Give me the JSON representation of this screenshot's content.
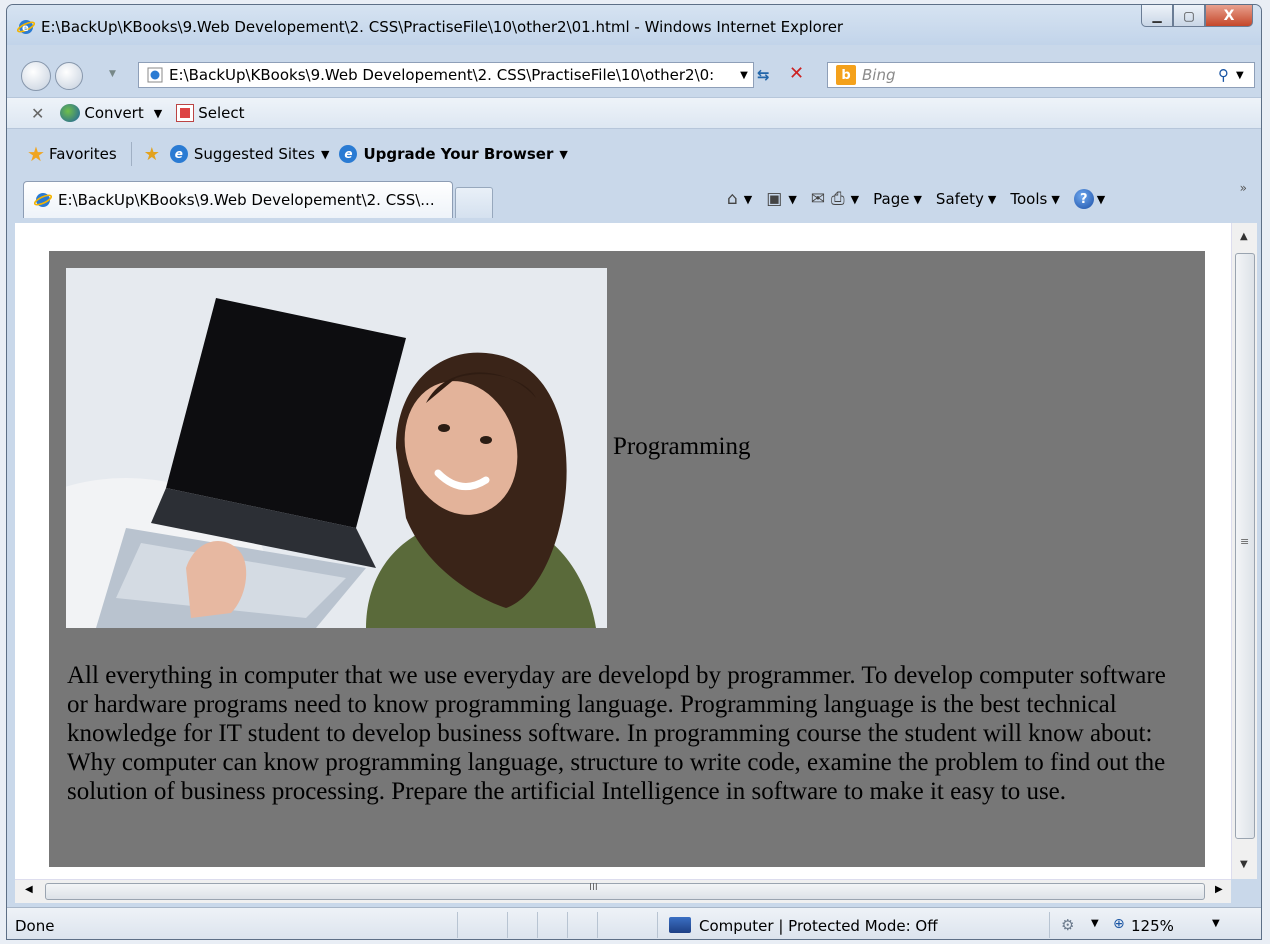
{
  "window": {
    "title": "E:\\BackUp\\KBooks\\9.Web Developement\\2. CSS\\PractiseFile\\10\\other2\\01.html - Windows Internet Explorer",
    "minimize": "▭",
    "maximize": "▢",
    "close": "X"
  },
  "address": {
    "url": "E:\\BackUp\\KBooks\\9.Web Developement\\2. CSS\\PractiseFile\\10\\other2\\0:",
    "search_placeholder": "Bing"
  },
  "command_bar": {
    "convert_label": "Convert",
    "select_label": "Select"
  },
  "favorites_bar": {
    "favorites_label": "Favorites",
    "items": [
      "Suggested Sites",
      "Upgrade Your Browser"
    ]
  },
  "tabs": [
    {
      "label": "E:\\BackUp\\KBooks\\9.Web Developement\\2. CSS\\..."
    }
  ],
  "toolbar": {
    "page_label": "Page",
    "safety_label": "Safety",
    "tools_label": "Tools"
  },
  "page": {
    "heading": "Programming",
    "paragraph": "All everything in computer that we use everyday are developd by programmer. To develop computer software or hardware programs need to know programming language. Programming language is the best technical knowledge for IT student to develop business software. In programming course the student will know about: Why computer can know programming language, structure to write code, examine the problem to find out the solution of business processing. Prepare the artificial Intelligence in software to make it easy to use.",
    "panel_color": "#777777"
  },
  "status_bar": {
    "status": "Done",
    "zone": "Computer | Protected Mode: Off",
    "zoom": "125%"
  }
}
